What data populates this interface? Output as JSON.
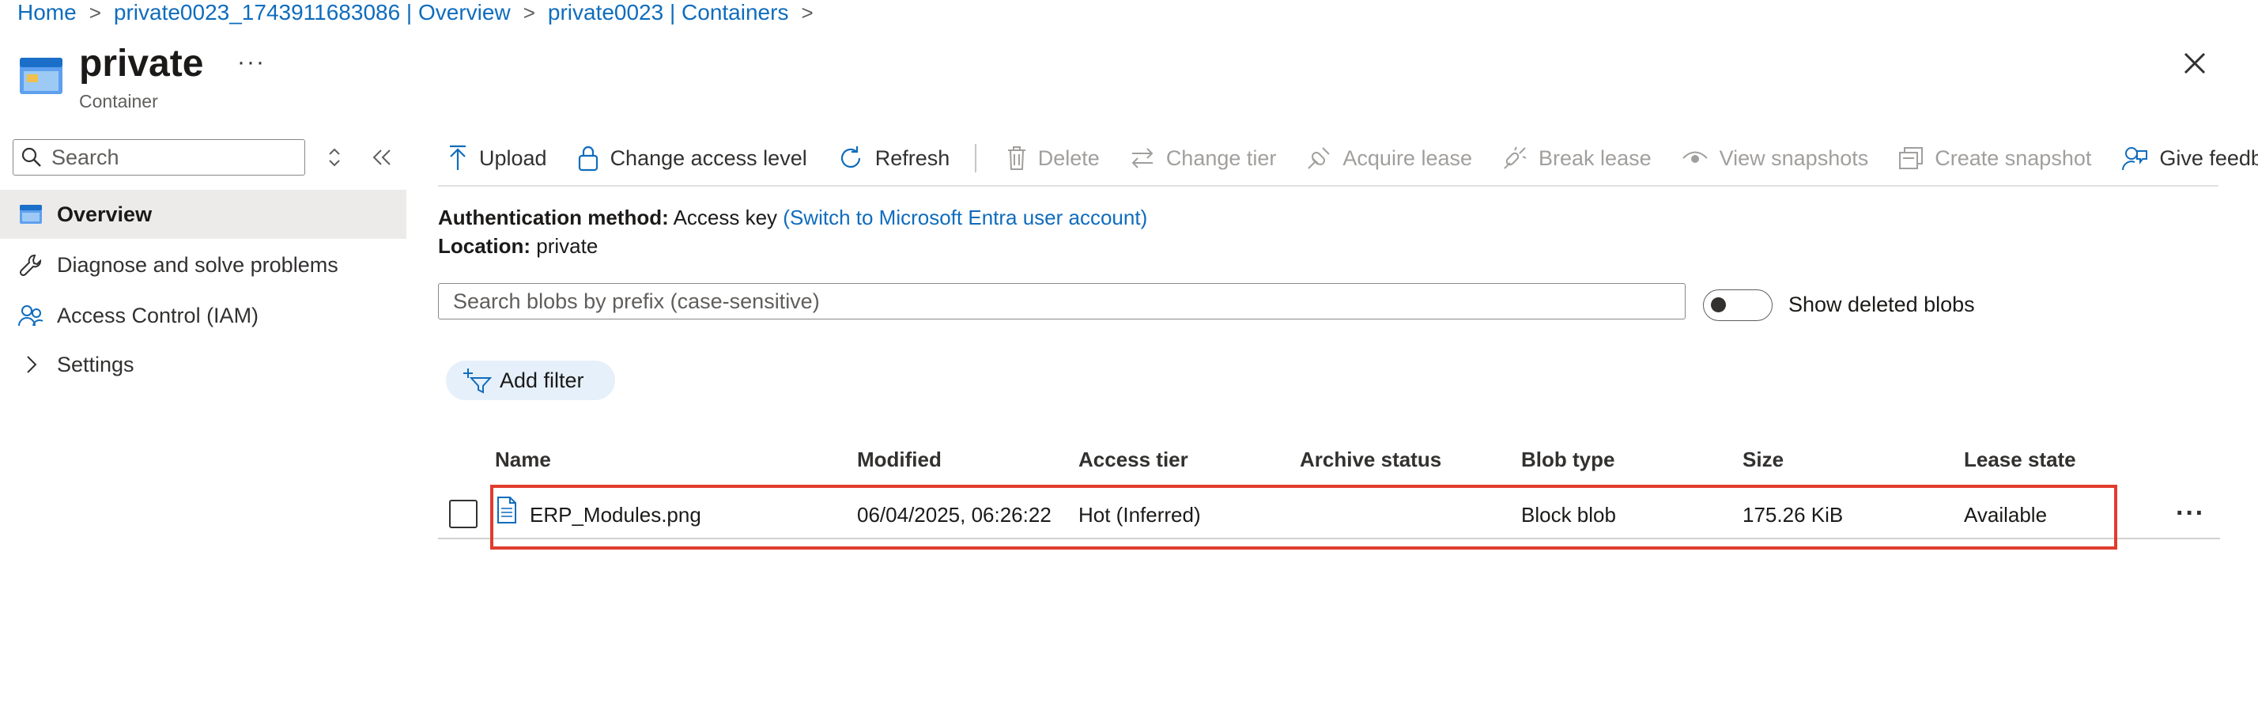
{
  "breadcrumb": {
    "items": [
      "Home",
      "private0023_1743911683086 | Overview",
      "private0023 | Containers"
    ],
    "separator": ">"
  },
  "header": {
    "title": "private",
    "subtitle": "Container",
    "more": "···"
  },
  "sidebar": {
    "search_placeholder": "Search",
    "items": [
      {
        "label": "Overview",
        "icon": "container-icon",
        "active": true
      },
      {
        "label": "Diagnose and solve problems",
        "icon": "wrench-icon"
      },
      {
        "label": "Access Control (IAM)",
        "icon": "people-icon"
      },
      {
        "label": "Settings",
        "icon": "chevron-right-icon"
      }
    ]
  },
  "toolbar": {
    "upload": "Upload",
    "change_access_level": "Change access level",
    "refresh": "Refresh",
    "delete": "Delete",
    "change_tier": "Change tier",
    "acquire_lease": "Acquire lease",
    "break_lease": "Break lease",
    "view_snapshots": "View snapshots",
    "create_snapshot": "Create snapshot",
    "give_feedback": "Give feedback"
  },
  "info": {
    "auth_label": "Authentication method:",
    "auth_value": "Access key",
    "auth_link": "(Switch to Microsoft Entra user account)",
    "location_label": "Location:",
    "location_value": "private"
  },
  "blob_search": {
    "placeholder": "Search blobs by prefix (case-sensitive)"
  },
  "show_deleted": {
    "label": "Show deleted blobs",
    "on": false
  },
  "add_filter": "Add filter",
  "table": {
    "columns": [
      "Name",
      "Modified",
      "Access tier",
      "Archive status",
      "Blob type",
      "Size",
      "Lease state"
    ],
    "rows": [
      {
        "name": "ERP_Modules.png",
        "modified": "06/04/2025, 06:26:22",
        "access_tier": "Hot (Inferred)",
        "archive_status": "",
        "blob_type": "Block blob",
        "size": "175.26 KiB",
        "lease_state": "Available"
      }
    ],
    "row_more": "···"
  },
  "colors": {
    "accent": "#0f6cbd",
    "highlight": "#e03c2e",
    "disabled": "#a19f9d"
  }
}
